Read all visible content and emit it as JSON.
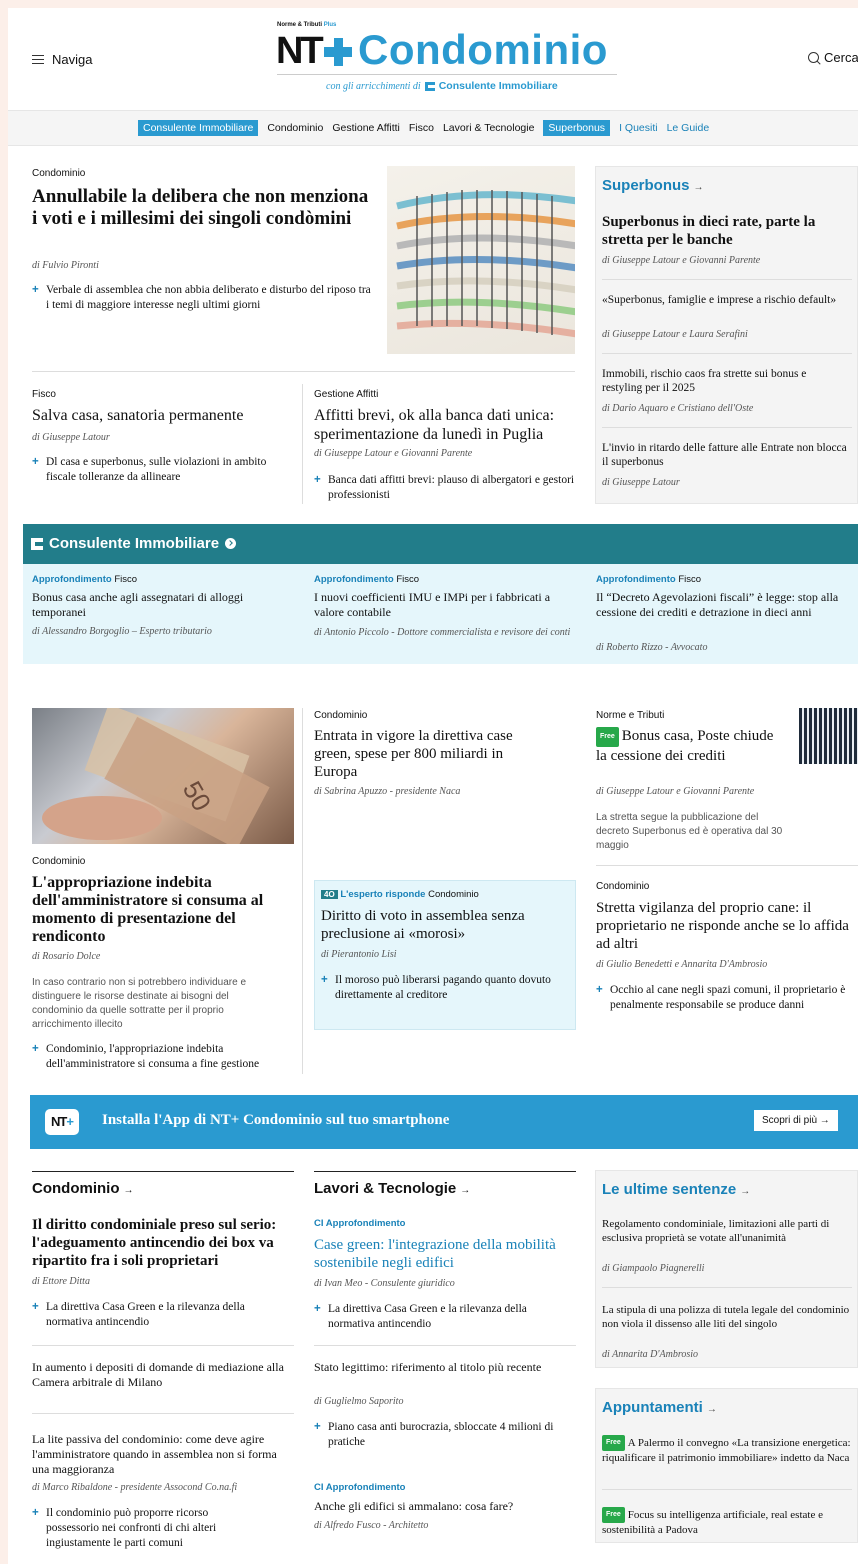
{
  "header": {
    "menu_label": "Naviga",
    "search_label": "Cerca",
    "logo_kicker": "Norme & Tributi",
    "logo_kicker_plus": "Plus",
    "logo_nt": "NT",
    "logo_name": "Condominio",
    "logo_sub_prefix": "con gli arricchimenti di",
    "logo_sub_brand": "Consulente Immobiliare"
  },
  "nav": {
    "items": [
      "Consulente Immobiliare",
      "Condominio",
      "Gestione Affitti",
      "Fisco",
      "Lavori & Tecnologie",
      "Superbonus",
      "I Quesiti",
      "Le Guide"
    ]
  },
  "top": {
    "lead": {
      "kicker": "Condominio",
      "title": "Annullabile la delibera che non menziona i voti e i millesimi dei singoli condòmini",
      "byline": "di Fulvio Pironti",
      "related": "Verbale di assemblea che non abbia deliberato e disturbo del riposo tra i temi di maggiore interesse negli ultimi giorni"
    },
    "fisco": {
      "kicker": "Fisco",
      "title": "Salva casa, sanatoria permanente",
      "byline": "di Giuseppe Latour",
      "related": "Dl casa e superbonus, sulle violazioni in ambito fiscale tolleranze da allineare"
    },
    "affitti": {
      "kicker": "Gestione Affitti",
      "title": "Affitti brevi, ok alla banca dati unica: sperimentazione da lunedì in Puglia",
      "byline": "di Giuseppe Latour e Giovanni Parente",
      "related": "Banca dati affitti brevi: plauso di albergatori e gestori professionisti"
    }
  },
  "superbonus": {
    "title": "Superbonus",
    "arrow": "→",
    "items": [
      {
        "title": "Superbonus in dieci rate, parte la stretta per le banche",
        "byline": "di Giuseppe Latour e Giovanni Parente"
      },
      {
        "title": "«Superbonus, famiglie e imprese a rischio default»",
        "byline": "di Giuseppe Latour e Laura Serafini"
      },
      {
        "title": "Immobili, rischio caos fra strette sui bonus e restyling per il 2025",
        "byline": "di Dario Aquaro e Cristiano dell'Oste"
      },
      {
        "title": "L'invio in ritardo delle fatture alle Entrate non blocca il superbonus",
        "byline": "di Giuseppe Latour"
      }
    ]
  },
  "ci": {
    "title": "Consulente Immobiliare",
    "items": [
      {
        "tag": "Approfondimento",
        "cat": "Fisco",
        "title": "Bonus casa anche agli assegnatari di alloggi temporanei",
        "byline": "di Alessandro Borgoglio – Esperto tributario"
      },
      {
        "tag": "Approfondimento",
        "cat": "Fisco",
        "title": "I nuovi coefficienti IMU e IMPi per i fabbricati a valore contabile",
        "byline": "di Antonio Piccolo - Dottore commercialista e revisore dei conti"
      },
      {
        "tag": "Approfondimento",
        "cat": "Fisco",
        "title": "Il “Decreto Agevolazioni fiscali” è legge: stop alla cessione dei crediti e detrazione in dieci anni",
        "byline": "di Roberto Rizzo - Avvocato"
      }
    ]
  },
  "mid": {
    "appropriazione": {
      "kicker": "Condominio",
      "title": "L'appropriazione indebita dell'amministratore si consuma al momento di presentazione del rendiconto",
      "byline": "di Rosario Dolce",
      "snippet": "In caso contrario non si potrebbero individuare e distinguere le risorse destinate ai bisogni del condominio da quelle sottratte per il proprio arricchimento illecito",
      "related": "Condominio, l'appropriazione indebita dell'amministratore si consuma a fine gestione"
    },
    "green": {
      "kicker": "Condominio",
      "title": "Entrata in vigore la direttiva case green, spese per 800 miliardi in Europa",
      "byline": "di Sabrina Apuzzo - presidente Naca"
    },
    "esperto": {
      "badge": "4O",
      "tag": "L'esperto risponde",
      "cat": "Condominio",
      "title": "Diritto di voto in assemblea senza preclusione ai «morosi»",
      "byline": "di Pierantonio Lisi",
      "related": "Il moroso può liberarsi pagando quanto dovuto direttamente al creditore"
    },
    "poste": {
      "kicker": "Norme e Tributi",
      "free": "Free",
      "title": "Bonus casa, Poste chiude la cessione dei crediti",
      "byline": "di Giuseppe Latour e Giovanni Parente",
      "snippet": "La stretta segue la pubblicazione del decreto Superbonus ed è operativa dal 30 maggio"
    },
    "cane": {
      "kicker": "Condominio",
      "title": "Stretta vigilanza del proprio cane: il proprietario ne risponde anche se lo affida ad altri",
      "byline": "di Giulio Benedetti e Annarita D'Ambrosio",
      "related": "Occhio al cane negli spazi comuni, il proprietario è penalmente responsabile se produce danni"
    }
  },
  "app": {
    "logo_nt": "NT",
    "logo_plus": "+",
    "text": "Installa l'App di NT+ Condominio sul tuo smartphone",
    "button": "Scopri di più →"
  },
  "bottom": {
    "condominio": {
      "title": "Condominio",
      "arrow": "→",
      "lead_title": "Il diritto condominiale preso sul serio: l'adeguamento antincendio dei box va ripartito fra i soli proprietari",
      "lead_byline": "di Ettore Ditta",
      "lead_related": "La direttiva Casa Green e la rilevanza della normativa antincendio",
      "item2_title": "In aumento i depositi di domande di mediazione alla Camera arbitrale di Milano",
      "item3_title": "La lite passiva del condominio: come deve agire l'amministratore quando in assemblea non si forma una maggioranza",
      "item3_byline": "di Marco Ribaldone - presidente Assocond Co.na.fi",
      "item3_related": "Il condominio può proporre ricorso possessorio nei confronti di chi alteri ingiustamente le parti comuni"
    },
    "lavori": {
      "title": "Lavori & Tecnologie",
      "arrow": "→",
      "tag": "CI Approfondimento",
      "lead_title": "Case green: l'integrazione della mobilità sostenibile negli edifici",
      "lead_byline": "di Ivan Meo - Consulente giuridico",
      "lead_related": "La direttiva Casa Green e la rilevanza della normativa antincendio",
      "item2_title": "Stato legittimo: riferimento al titolo più recente",
      "item2_byline": "di Guglielmo Saporito",
      "item2_related": "Piano casa anti burocrazia, sbloccate 4 milioni di pratiche",
      "item3_tag": "CI Approfondimento",
      "item3_title": "Anche gli edifici si ammalano: cosa fare?",
      "item3_byline": "di Alfredo Fusco - Architetto"
    },
    "sentenze": {
      "title": "Le ultime sentenze",
      "arrow": "→",
      "items": [
        {
          "title": "Regolamento condominiale, limitazioni alle parti di esclusiva proprietà se votate all'unanimità",
          "byline": "di Giampaolo Piagnerelli"
        },
        {
          "title": "La stipula di una polizza di tutela legale del condominio non viola il dissenso alle liti del singolo",
          "byline": "di Annarita D'Ambrosio"
        }
      ]
    },
    "appuntamenti": {
      "title": "Appuntamenti",
      "arrow": "→",
      "free": "Free",
      "items": [
        {
          "title": "A Palermo il convegno «La transizione energetica: riqualificare il patrimonio immobiliare» indetto da Naca"
        },
        {
          "title": "Focus su intelligenza artificiale, real estate e sostenibilità a Padova"
        }
      ]
    }
  },
  "colors": {
    "brand": "#2a9ad0",
    "ci": "#227d8a",
    "ci_bg": "#e5f6fb",
    "free": "#27a84a"
  }
}
